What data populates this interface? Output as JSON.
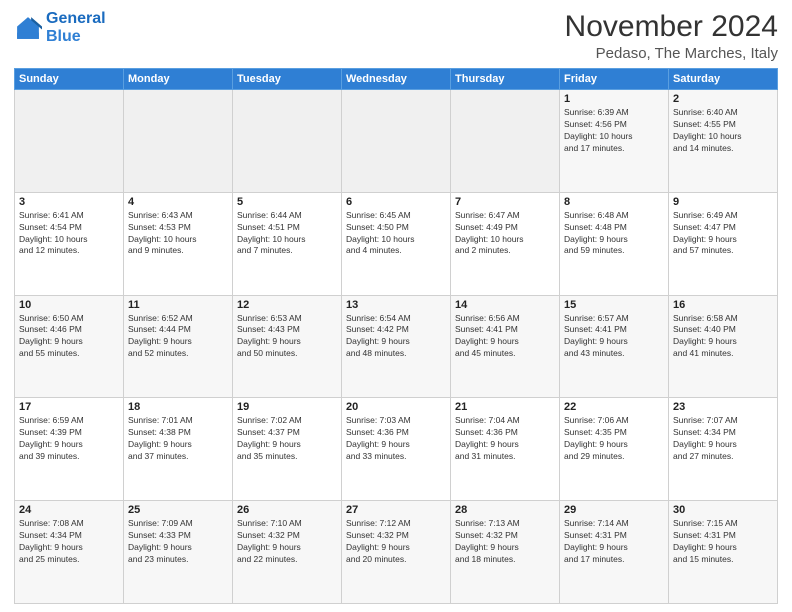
{
  "logo": {
    "line1": "General",
    "line2": "Blue"
  },
  "header": {
    "month_title": "November 2024",
    "location": "Pedaso, The Marches, Italy"
  },
  "weekdays": [
    "Sunday",
    "Monday",
    "Tuesday",
    "Wednesday",
    "Thursday",
    "Friday",
    "Saturday"
  ],
  "weeks": [
    [
      {
        "day": "",
        "info": ""
      },
      {
        "day": "",
        "info": ""
      },
      {
        "day": "",
        "info": ""
      },
      {
        "day": "",
        "info": ""
      },
      {
        "day": "",
        "info": ""
      },
      {
        "day": "1",
        "info": "Sunrise: 6:39 AM\nSunset: 4:56 PM\nDaylight: 10 hours\nand 17 minutes."
      },
      {
        "day": "2",
        "info": "Sunrise: 6:40 AM\nSunset: 4:55 PM\nDaylight: 10 hours\nand 14 minutes."
      }
    ],
    [
      {
        "day": "3",
        "info": "Sunrise: 6:41 AM\nSunset: 4:54 PM\nDaylight: 10 hours\nand 12 minutes."
      },
      {
        "day": "4",
        "info": "Sunrise: 6:43 AM\nSunset: 4:53 PM\nDaylight: 10 hours\nand 9 minutes."
      },
      {
        "day": "5",
        "info": "Sunrise: 6:44 AM\nSunset: 4:51 PM\nDaylight: 10 hours\nand 7 minutes."
      },
      {
        "day": "6",
        "info": "Sunrise: 6:45 AM\nSunset: 4:50 PM\nDaylight: 10 hours\nand 4 minutes."
      },
      {
        "day": "7",
        "info": "Sunrise: 6:47 AM\nSunset: 4:49 PM\nDaylight: 10 hours\nand 2 minutes."
      },
      {
        "day": "8",
        "info": "Sunrise: 6:48 AM\nSunset: 4:48 PM\nDaylight: 9 hours\nand 59 minutes."
      },
      {
        "day": "9",
        "info": "Sunrise: 6:49 AM\nSunset: 4:47 PM\nDaylight: 9 hours\nand 57 minutes."
      }
    ],
    [
      {
        "day": "10",
        "info": "Sunrise: 6:50 AM\nSunset: 4:46 PM\nDaylight: 9 hours\nand 55 minutes."
      },
      {
        "day": "11",
        "info": "Sunrise: 6:52 AM\nSunset: 4:44 PM\nDaylight: 9 hours\nand 52 minutes."
      },
      {
        "day": "12",
        "info": "Sunrise: 6:53 AM\nSunset: 4:43 PM\nDaylight: 9 hours\nand 50 minutes."
      },
      {
        "day": "13",
        "info": "Sunrise: 6:54 AM\nSunset: 4:42 PM\nDaylight: 9 hours\nand 48 minutes."
      },
      {
        "day": "14",
        "info": "Sunrise: 6:56 AM\nSunset: 4:41 PM\nDaylight: 9 hours\nand 45 minutes."
      },
      {
        "day": "15",
        "info": "Sunrise: 6:57 AM\nSunset: 4:41 PM\nDaylight: 9 hours\nand 43 minutes."
      },
      {
        "day": "16",
        "info": "Sunrise: 6:58 AM\nSunset: 4:40 PM\nDaylight: 9 hours\nand 41 minutes."
      }
    ],
    [
      {
        "day": "17",
        "info": "Sunrise: 6:59 AM\nSunset: 4:39 PM\nDaylight: 9 hours\nand 39 minutes."
      },
      {
        "day": "18",
        "info": "Sunrise: 7:01 AM\nSunset: 4:38 PM\nDaylight: 9 hours\nand 37 minutes."
      },
      {
        "day": "19",
        "info": "Sunrise: 7:02 AM\nSunset: 4:37 PM\nDaylight: 9 hours\nand 35 minutes."
      },
      {
        "day": "20",
        "info": "Sunrise: 7:03 AM\nSunset: 4:36 PM\nDaylight: 9 hours\nand 33 minutes."
      },
      {
        "day": "21",
        "info": "Sunrise: 7:04 AM\nSunset: 4:36 PM\nDaylight: 9 hours\nand 31 minutes."
      },
      {
        "day": "22",
        "info": "Sunrise: 7:06 AM\nSunset: 4:35 PM\nDaylight: 9 hours\nand 29 minutes."
      },
      {
        "day": "23",
        "info": "Sunrise: 7:07 AM\nSunset: 4:34 PM\nDaylight: 9 hours\nand 27 minutes."
      }
    ],
    [
      {
        "day": "24",
        "info": "Sunrise: 7:08 AM\nSunset: 4:34 PM\nDaylight: 9 hours\nand 25 minutes."
      },
      {
        "day": "25",
        "info": "Sunrise: 7:09 AM\nSunset: 4:33 PM\nDaylight: 9 hours\nand 23 minutes."
      },
      {
        "day": "26",
        "info": "Sunrise: 7:10 AM\nSunset: 4:32 PM\nDaylight: 9 hours\nand 22 minutes."
      },
      {
        "day": "27",
        "info": "Sunrise: 7:12 AM\nSunset: 4:32 PM\nDaylight: 9 hours\nand 20 minutes."
      },
      {
        "day": "28",
        "info": "Sunrise: 7:13 AM\nSunset: 4:32 PM\nDaylight: 9 hours\nand 18 minutes."
      },
      {
        "day": "29",
        "info": "Sunrise: 7:14 AM\nSunset: 4:31 PM\nDaylight: 9 hours\nand 17 minutes."
      },
      {
        "day": "30",
        "info": "Sunrise: 7:15 AM\nSunset: 4:31 PM\nDaylight: 9 hours\nand 15 minutes."
      }
    ]
  ]
}
